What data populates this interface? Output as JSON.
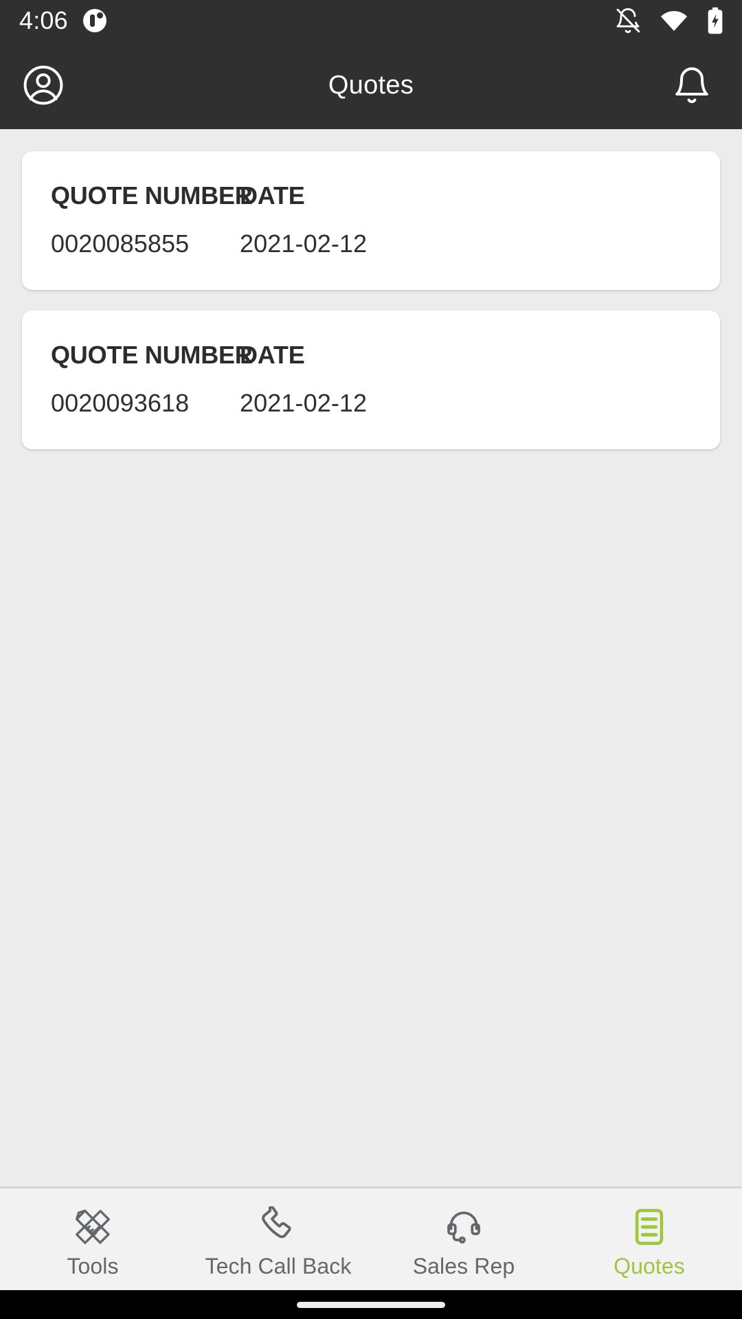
{
  "theme": {
    "status_bar_bg": "#303031",
    "app_bar_bg": "#303031",
    "page_bg": "#ECECEC",
    "card_bg": "#FFFFFF",
    "nav_bg": "#F2F2F2",
    "accent_green": "#A0C63D",
    "text_dark": "#2C2C2C",
    "text_muted": "#63666A",
    "gesture_bar_bg": "#000000"
  },
  "status_bar": {
    "time": "4:06",
    "app_notification_icon": "app-badge-icon",
    "icons": [
      {
        "name": "notifications-off-icon",
        "label": "Notifications muted"
      },
      {
        "name": "wifi-icon",
        "label": "Wi-Fi connected"
      },
      {
        "name": "battery-charging-icon",
        "label": "Battery charging"
      }
    ]
  },
  "app_bar": {
    "title": "Quotes",
    "left_icon": "account-circle-icon",
    "right_icon": "notification-bell-icon"
  },
  "quotes_list": {
    "columns": [
      "QUOTE NUMBER",
      "DATE"
    ],
    "rows": [
      {
        "quote_number": "0020085855",
        "date": "2021-02-12"
      },
      {
        "quote_number": "0020093618",
        "date": "2021-02-12"
      }
    ]
  },
  "bottom_nav": {
    "active_index": 3,
    "items": [
      {
        "label": "Tools",
        "icon": "ruler-pencil-icon",
        "active": false
      },
      {
        "label": "Tech Call Back",
        "icon": "phone-icon",
        "active": false
      },
      {
        "label": "Sales Rep",
        "icon": "headset-icon",
        "active": false
      },
      {
        "label": "Quotes",
        "icon": "document-list-icon",
        "active": true
      }
    ]
  },
  "gesture_bar": {
    "handle": "home-gesture-pill"
  }
}
